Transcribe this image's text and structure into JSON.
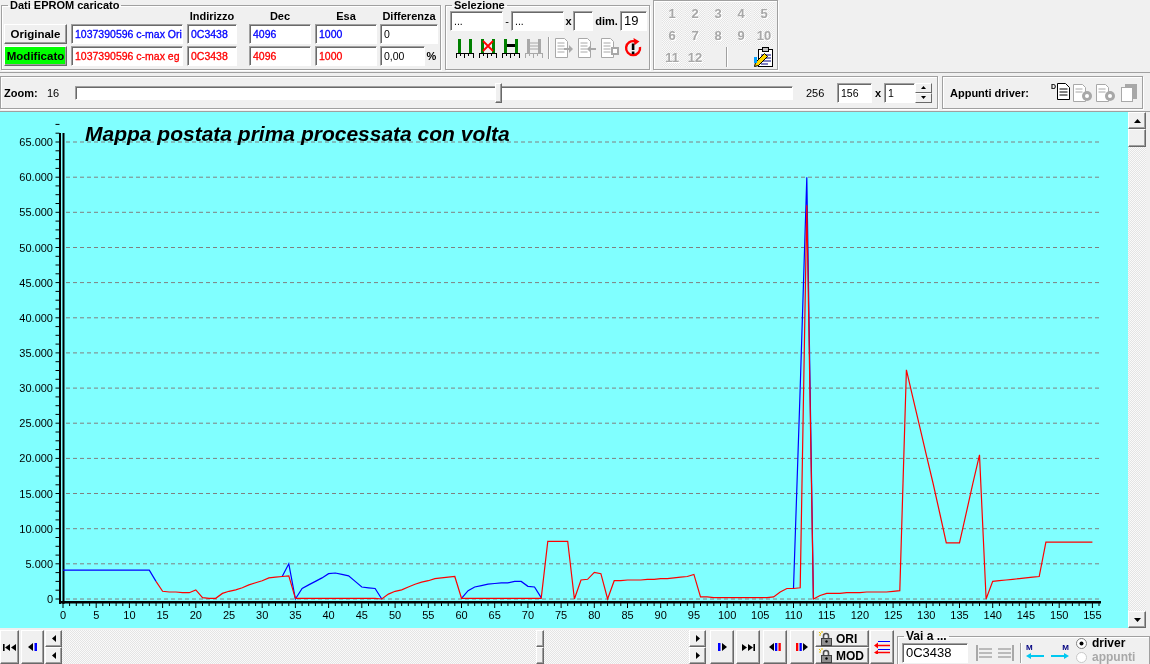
{
  "eprom": {
    "title": "Dati EPROM caricato",
    "columns": [
      "Indirizzo",
      "Dec",
      "Esa",
      "Differenza"
    ],
    "rows": [
      {
        "label": "Originale",
        "active": false,
        "color": "#0000ff",
        "name": "1037390596 c-max Ori",
        "address": "0C3438",
        "dec": "4096",
        "hex": "1000",
        "difference": "0"
      },
      {
        "label": "Modificato",
        "active": true,
        "color": "#ff0000",
        "name": "1037390596 c-max eg",
        "address": "0C3438",
        "dec": "4096",
        "hex": "1000",
        "difference": "0,00",
        "unit": "%"
      }
    ]
  },
  "selection": {
    "title": "Selezione",
    "from": "...",
    "dash": "-",
    "to": "...",
    "times": "x",
    "dim_label": "dim.",
    "dim": "19",
    "tools": [
      {
        "kind": "bars",
        "disabled": false
      },
      {
        "kind": "bars-cross",
        "disabled": false
      },
      {
        "kind": "bars-join",
        "disabled": false
      },
      {
        "kind": "bars-lines",
        "disabled": true
      },
      {
        "kind": "doc-in",
        "disabled": true
      },
      {
        "kind": "doc-out",
        "disabled": true
      },
      {
        "kind": "doc-box",
        "disabled": true
      },
      {
        "kind": "reset",
        "disabled": false
      }
    ]
  },
  "maps": {
    "buttons": [
      {
        "label": "1",
        "disabled": true
      },
      {
        "label": "2",
        "disabled": true
      },
      {
        "label": "3",
        "disabled": true
      },
      {
        "label": "4",
        "disabled": true
      },
      {
        "label": "5",
        "disabled": true
      },
      {
        "label": "6",
        "disabled": true
      },
      {
        "label": "7",
        "disabled": true
      },
      {
        "label": "8",
        "disabled": true
      },
      {
        "label": "9",
        "disabled": true
      },
      {
        "label": "10",
        "disabled": true
      },
      {
        "label": "11",
        "disabled": true
      },
      {
        "label": "12",
        "disabled": true
      }
    ]
  },
  "zoom": {
    "label": "Zoom:",
    "min": "16",
    "level": 0.59,
    "max": "256",
    "value": "156",
    "times": "x",
    "factor": "1"
  },
  "driver_clipboard": {
    "label": "Appunti driver:",
    "tools": [
      {
        "kind": "paste",
        "label": "D",
        "disabled": false
      },
      {
        "kind": "gear",
        "disabled": true
      },
      {
        "kind": "gear",
        "disabled": true
      },
      {
        "kind": "clear",
        "disabled": true
      }
    ]
  },
  "chart": {
    "chart_data": {
      "type": "line",
      "title": "Mappa postata prima processata con volta",
      "grid": true,
      "x": [
        0,
        1,
        2,
        3,
        4,
        5,
        6,
        7,
        8,
        9,
        10,
        11,
        12,
        13,
        14,
        15,
        16,
        17,
        18,
        19,
        20,
        21,
        22,
        23,
        24,
        25,
        26,
        27,
        28,
        29,
        30,
        31,
        32,
        33,
        34,
        35,
        36,
        37,
        38,
        39,
        40,
        41,
        42,
        43,
        44,
        45,
        46,
        47,
        48,
        49,
        50,
        51,
        52,
        53,
        54,
        55,
        56,
        57,
        58,
        59,
        60,
        61,
        62,
        63,
        64,
        65,
        66,
        67,
        68,
        69,
        70,
        71,
        72,
        73,
        74,
        75,
        76,
        77,
        78,
        79,
        80,
        81,
        82,
        83,
        84,
        85,
        86,
        87,
        88,
        89,
        90,
        91,
        92,
        93,
        94,
        95,
        96,
        97,
        98,
        99,
        100,
        101,
        102,
        103,
        104,
        105,
        106,
        107,
        108,
        109,
        110,
        111,
        112,
        113,
        114,
        115,
        116,
        117,
        118,
        119,
        120,
        121,
        122,
        123,
        124,
        125,
        126,
        127,
        128,
        129,
        130,
        131,
        132,
        133,
        134,
        135,
        136,
        137,
        138,
        139,
        140,
        141,
        142,
        143,
        144,
        145,
        146,
        147,
        148,
        149,
        150,
        151,
        152,
        153,
        154,
        155
      ],
      "series": [
        {
          "color": "#0000ff",
          "values": [
            4100,
            4100,
            4100,
            4100,
            4100,
            4100,
            4100,
            4100,
            4100,
            4100,
            4100,
            4100,
            4100,
            4100,
            2500,
            null,
            null,
            null,
            null,
            null,
            null,
            null,
            null,
            null,
            null,
            null,
            null,
            null,
            null,
            null,
            null,
            null,
            null,
            3200,
            5000,
            0,
            1500,
            2000,
            2500,
            3000,
            3600,
            3700,
            3500,
            3300,
            2500,
            1700,
            1600,
            1500,
            0,
            null,
            null,
            null,
            null,
            null,
            null,
            null,
            null,
            null,
            null,
            null,
            100,
            1200,
            1700,
            1900,
            2100,
            2200,
            2300,
            2300,
            2500,
            2500,
            1800,
            1700,
            200,
            null,
            null,
            null,
            null,
            null,
            null,
            null,
            null,
            null,
            null,
            null,
            null,
            null,
            null,
            null,
            null,
            null,
            null,
            null,
            null,
            null,
            null,
            null,
            null,
            null,
            null,
            null,
            null,
            null,
            null,
            null,
            null,
            null,
            null,
            null,
            null,
            null,
            1500,
            30000,
            60000,
            0,
            null,
            null,
            null,
            null,
            null,
            null,
            null,
            null,
            null,
            null,
            null,
            null,
            null,
            null,
            null,
            null,
            null,
            null,
            null,
            null,
            null,
            null,
            null,
            null,
            null,
            null,
            null,
            null,
            null,
            null,
            null,
            null,
            null,
            null,
            null,
            null,
            null,
            null,
            null,
            null,
            null,
            null
          ]
        },
        {
          "color": "#ff0000",
          "values": [
            null,
            null,
            null,
            null,
            null,
            null,
            null,
            null,
            null,
            null,
            null,
            null,
            null,
            null,
            2500,
            1100,
            1000,
            1000,
            900,
            900,
            1300,
            200,
            100,
            100,
            800,
            1100,
            1300,
            1600,
            2000,
            2300,
            2600,
            3000,
            3100,
            3200,
            3300,
            100,
            100,
            100,
            100,
            100,
            100,
            100,
            100,
            100,
            100,
            100,
            100,
            100,
            0,
            700,
            1100,
            1300,
            1700,
            2100,
            2400,
            2600,
            2900,
            3000,
            3100,
            3200,
            100,
            100,
            100,
            100,
            100,
            100,
            100,
            100,
            100,
            100,
            100,
            100,
            100,
            8200,
            8200,
            8200,
            8200,
            0,
            2700,
            2800,
            3800,
            3600,
            0,
            2600,
            2600,
            2700,
            2700,
            2700,
            2800,
            2800,
            2900,
            2900,
            3000,
            3100,
            3200,
            3500,
            300,
            300,
            200,
            200,
            200,
            200,
            200,
            200,
            200,
            200,
            200,
            300,
            1000,
            1500,
            1500,
            1600,
            56000,
            0,
            500,
            800,
            800,
            800,
            900,
            900,
            900,
            1000,
            1000,
            1000,
            1000,
            1100,
            1200,
            32600,
            28500,
            24500,
            20500,
            16500,
            12300,
            8000,
            8000,
            8000,
            12200,
            16400,
            20500,
            0,
            2500,
            2600,
            2700,
            2800,
            2900,
            3000,
            3100,
            3200,
            8100,
            8100,
            8100,
            8100,
            8100,
            8100,
            8100,
            8100
          ]
        }
      ],
      "xlim": [
        0,
        156
      ],
      "ylim": [
        0,
        65000
      ],
      "xticks": [
        0,
        5,
        10,
        15,
        20,
        25,
        30,
        35,
        40,
        45,
        50,
        55,
        60,
        65,
        70,
        75,
        80,
        85,
        90,
        95,
        100,
        105,
        110,
        115,
        120,
        125,
        130,
        135,
        140,
        145,
        150,
        155
      ],
      "yticks": [
        {
          "value": 0,
          "label": "0"
        },
        {
          "value": 5000,
          "label": "5.000"
        },
        {
          "value": 10000,
          "label": "10.000"
        },
        {
          "value": 15000,
          "label": "15.000"
        },
        {
          "value": 20000,
          "label": "20.000"
        },
        {
          "value": 25000,
          "label": "25.000"
        },
        {
          "value": 30000,
          "label": "30.000"
        },
        {
          "value": 35000,
          "label": "35.000"
        },
        {
          "value": 40000,
          "label": "40.000"
        },
        {
          "value": 45000,
          "label": "45.000"
        },
        {
          "value": 50000,
          "label": "50.000"
        },
        {
          "value": 55000,
          "label": "55.000"
        },
        {
          "value": 60000,
          "label": "60.000"
        },
        {
          "value": 65000,
          "label": "65.000"
        }
      ]
    }
  },
  "lock_buttons": [
    {
      "label": "ORI"
    },
    {
      "label": "MOD"
    }
  ],
  "goto": {
    "title": "Vai a ...",
    "value": "0C3438",
    "tools": [
      {
        "kind": "left",
        "disabled": true
      },
      {
        "kind": "right",
        "disabled": true
      }
    ],
    "move_buttons": [
      {
        "kind": "left",
        "label": "M"
      },
      {
        "kind": "right",
        "label": "M"
      }
    ],
    "target_options": [
      {
        "label": "driver",
        "selected": true,
        "disabled": false
      },
      {
        "label": "appunti",
        "selected": false,
        "disabled": true
      }
    ]
  }
}
